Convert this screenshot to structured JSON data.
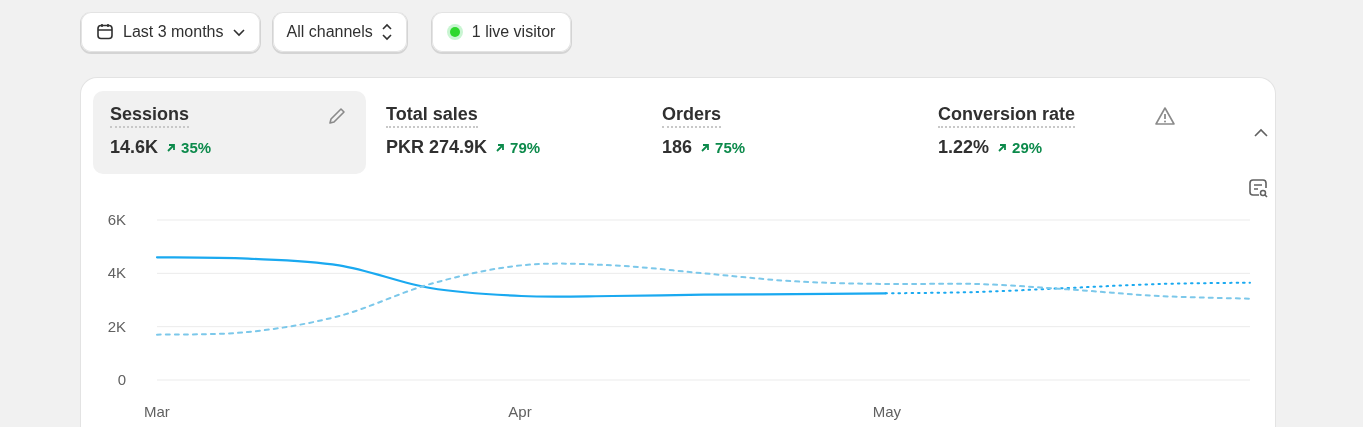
{
  "filters": [
    {
      "kind": "date",
      "label": "Last 3 months"
    },
    {
      "kind": "select",
      "label": "All channels"
    },
    {
      "kind": "live",
      "label": "1 live visitor"
    }
  ],
  "metrics": [
    {
      "label": "Sessions",
      "value": "14.6K",
      "change": "35%",
      "selected": true,
      "warning": false
    },
    {
      "label": "Total sales",
      "value": "PKR 274.9K",
      "change": "79%",
      "selected": false,
      "warning": false
    },
    {
      "label": "Orders",
      "value": "186",
      "change": "75%",
      "selected": false,
      "warning": false
    },
    {
      "label": "Conversion rate",
      "value": "1.22%",
      "change": "29%",
      "selected": false,
      "warning": true
    }
  ],
  "chart_data": {
    "type": "line",
    "categories": [
      "Mar",
      null,
      null,
      null,
      "Apr",
      null,
      null,
      null,
      "May",
      null,
      null,
      null,
      null
    ],
    "ylim": [
      0,
      6000
    ],
    "yticks": [
      {
        "value": 0,
        "label": "0"
      },
      {
        "value": 2000,
        "label": "2K"
      },
      {
        "value": 4000,
        "label": "4K"
      },
      {
        "value": 6000,
        "label": "6K"
      }
    ],
    "series": [
      {
        "color": "#1aa9f0",
        "line_style": "solid",
        "values": [
          4600,
          4550,
          4300,
          3450,
          3150,
          3150,
          3200,
          3220,
          3250,
          null,
          null,
          null,
          null
        ]
      },
      {
        "color": "#1aa9f0",
        "line_style": "dotted",
        "values": [
          null,
          null,
          null,
          null,
          null,
          null,
          null,
          null,
          3250,
          3300,
          3450,
          3600,
          3650
        ]
      },
      {
        "color": "#7cc8ea",
        "line_style": "dashed",
        "values": [
          1700,
          1800,
          2400,
          3600,
          4300,
          4300,
          4000,
          3700,
          3600,
          3600,
          3400,
          3150,
          3050
        ]
      }
    ]
  }
}
